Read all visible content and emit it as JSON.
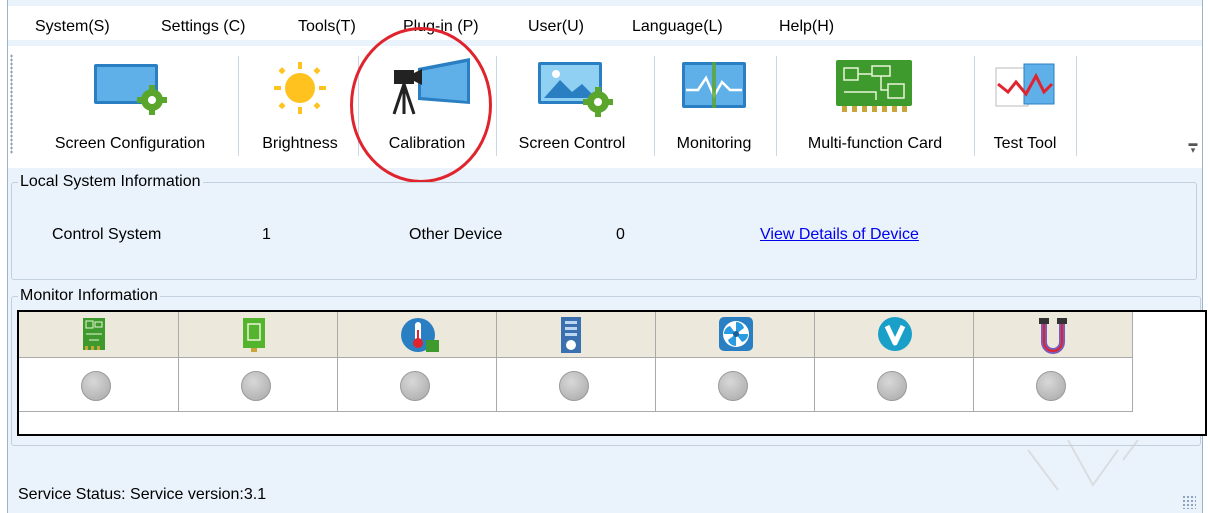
{
  "menu": [
    "System(S)",
    "Settings (C)",
    "Tools(T)",
    "Plug-in (P)",
    "User(U)",
    "Language(L)",
    "Help(H)"
  ],
  "toolbar": {
    "buttons": [
      {
        "label": "Screen Configuration",
        "icon": "screen-config-icon"
      },
      {
        "label": "Brightness",
        "icon": "sun-icon"
      },
      {
        "label": "Calibration",
        "icon": "camera-screen-icon"
      },
      {
        "label": "Screen Control",
        "icon": "screen-control-icon"
      },
      {
        "label": "Monitoring",
        "icon": "monitor-wave-icon"
      },
      {
        "label": "Multi-function Card",
        "icon": "circuit-board-icon"
      },
      {
        "label": "Test Tool",
        "icon": "chart-test-icon"
      }
    ]
  },
  "local": {
    "title": "Local System Information",
    "control_label": "Control System",
    "control_value": "1",
    "other_label": "Other Device",
    "other_value": "0",
    "details_link": "View Details of Device"
  },
  "monitor": {
    "title": "Monitor Information",
    "columns": [
      "receiving-card-icon",
      "module-card-icon",
      "temperature-icon",
      "power-supply-icon",
      "fan-icon",
      "voltage-icon",
      "cable-icon"
    ]
  },
  "status": {
    "text": "Service Status:  Service version:3.1"
  },
  "colors": {
    "accent_red": "#e0242e",
    "link": "#0000ee",
    "panel_bg": "#eaf3fb"
  }
}
